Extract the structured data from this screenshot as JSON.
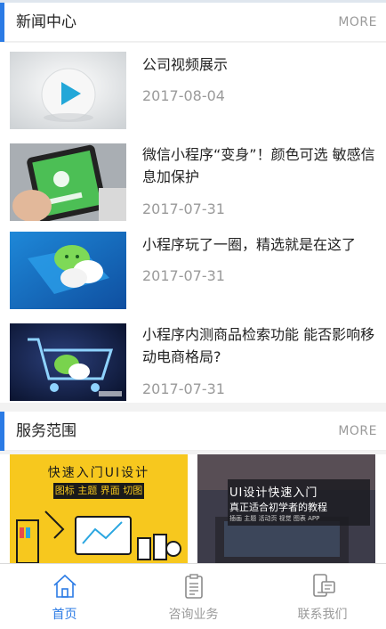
{
  "news": {
    "title": "新闻中心",
    "more": "MORE",
    "items": [
      {
        "title": "公司视频展示",
        "date": "2017-08-04",
        "thumb_icon": "play-icon"
      },
      {
        "title": "微信小程序“变身”！颜色可选 敏感信息加保护",
        "date": "2017-07-31",
        "thumb_icon": "phone-icon"
      },
      {
        "title": "小程序玩了一圈，精选就是在这了",
        "date": "2017-07-31",
        "thumb_icon": "wechat-icon"
      },
      {
        "title": "小程序内测商品检索功能 能否影响移动电商格局?",
        "date": "2017-07-31",
        "thumb_icon": "cart-icon"
      }
    ]
  },
  "services": {
    "title": "服务范围",
    "more": "MORE",
    "cards": [
      {
        "heading": "快速入门UI设计",
        "subheading": "图标 主题 界面 切图",
        "bg": "#f7c81e"
      },
      {
        "heading": "UI设计快速入门",
        "subheading": "真正适合初学者的教程",
        "tags": "插画 主题 活动页 视觉 图表 APP",
        "bg": "#3a3a4a"
      }
    ]
  },
  "tabbar": {
    "items": [
      {
        "label": "首页",
        "icon": "home-icon",
        "active": true
      },
      {
        "label": "咨询业务",
        "icon": "clipboard-icon",
        "active": false
      },
      {
        "label": "联系我们",
        "icon": "contact-phone-icon",
        "active": false
      }
    ]
  },
  "colors": {
    "accent": "#2b7be5",
    "muted": "#9a9a9a"
  }
}
